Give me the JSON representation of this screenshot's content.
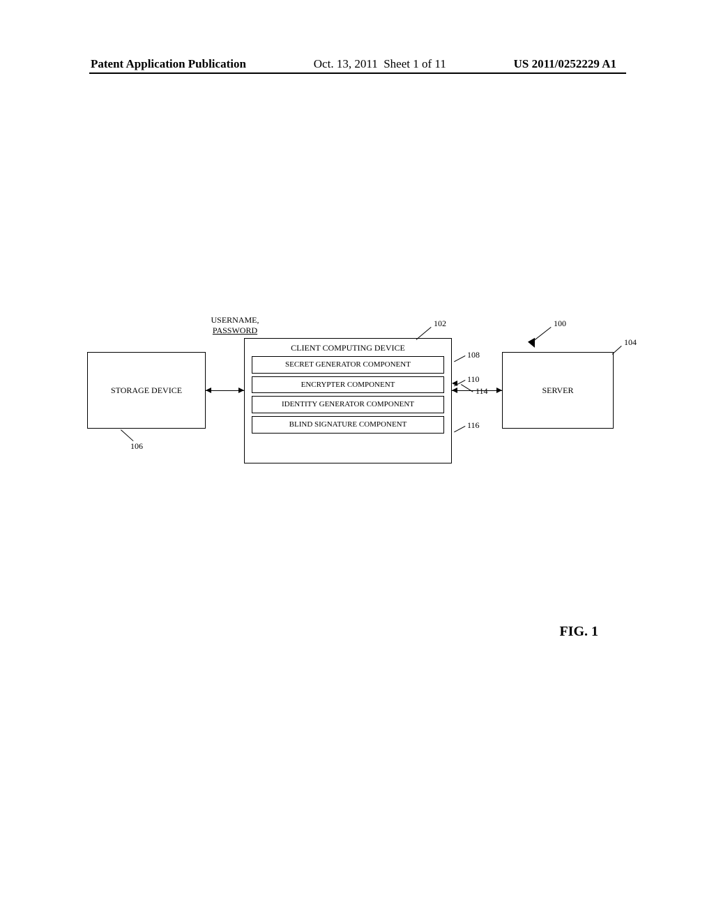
{
  "header": {
    "left": "Patent Application Publication",
    "center_date": "Oct. 13, 2011",
    "center_sheet": "Sheet 1 of 11",
    "right": "US 2011/0252229 A1"
  },
  "diagram": {
    "input_line1": "USERNAME,",
    "input_line2": "PASSWORD",
    "storage": "STORAGE DEVICE",
    "client_title": "CLIENT COMPUTING DEVICE",
    "secret": "SECRET GENERATOR COMPONENT",
    "encrypter": "ENCRYPTER COMPONENT",
    "identity": "IDENTITY GENERATOR COMPONENT",
    "blind": "BLIND SIGNATURE COMPONENT",
    "server": "SERVER",
    "refs": {
      "r100": "100",
      "r102": "102",
      "r104": "104",
      "r106": "106",
      "r108": "108",
      "r110": "110",
      "r114": "114",
      "r116": "116"
    }
  },
  "figure_label": "FIG. 1"
}
